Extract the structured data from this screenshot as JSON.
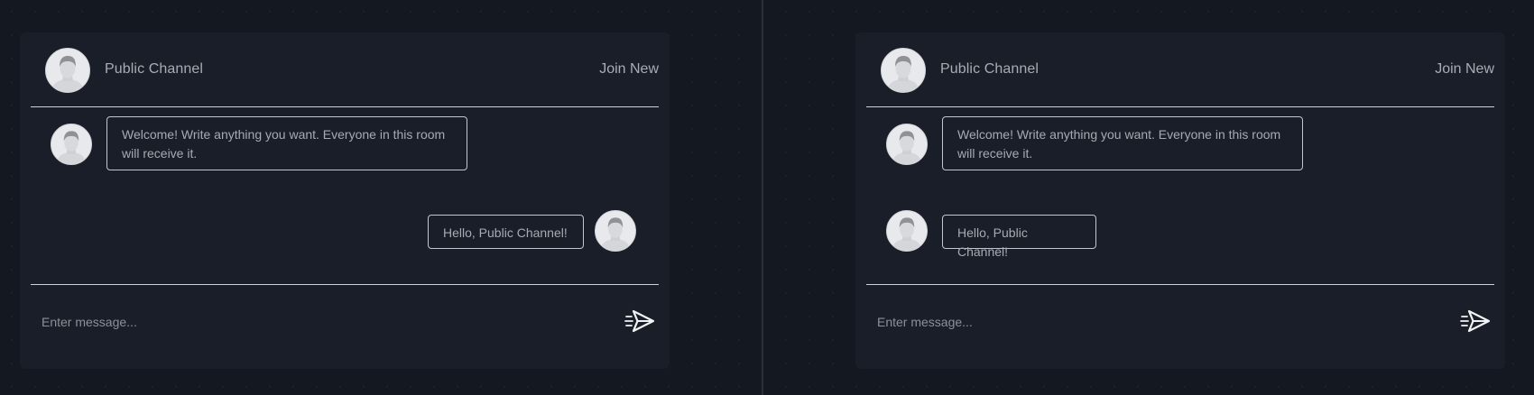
{
  "panels": [
    {
      "header": {
        "channel_name": "Public Channel",
        "join_label": "Join New"
      },
      "messages": [
        {
          "text": "Welcome! Write anything you want. Everyone in this room will receive it.",
          "side": "left"
        },
        {
          "text": "Hello, Public Channel!",
          "side": "right"
        }
      ],
      "input": {
        "placeholder": "Enter message..."
      }
    },
    {
      "header": {
        "channel_name": "Public Channel",
        "join_label": "Join New"
      },
      "messages": [
        {
          "text": "Welcome! Write anything you want. Everyone in this room will receive it.",
          "side": "left"
        },
        {
          "text": "Hello, Public Channel!",
          "side": "left"
        }
      ],
      "input": {
        "placeholder": "Enter message..."
      }
    }
  ],
  "icons": {
    "avatar": "user-avatar-icon",
    "send": "paper-plane-send-icon"
  },
  "colors": {
    "background": "#141821",
    "panel": "#1a1e28",
    "text": "#a9acb3",
    "rule": "#cfd2d8"
  }
}
